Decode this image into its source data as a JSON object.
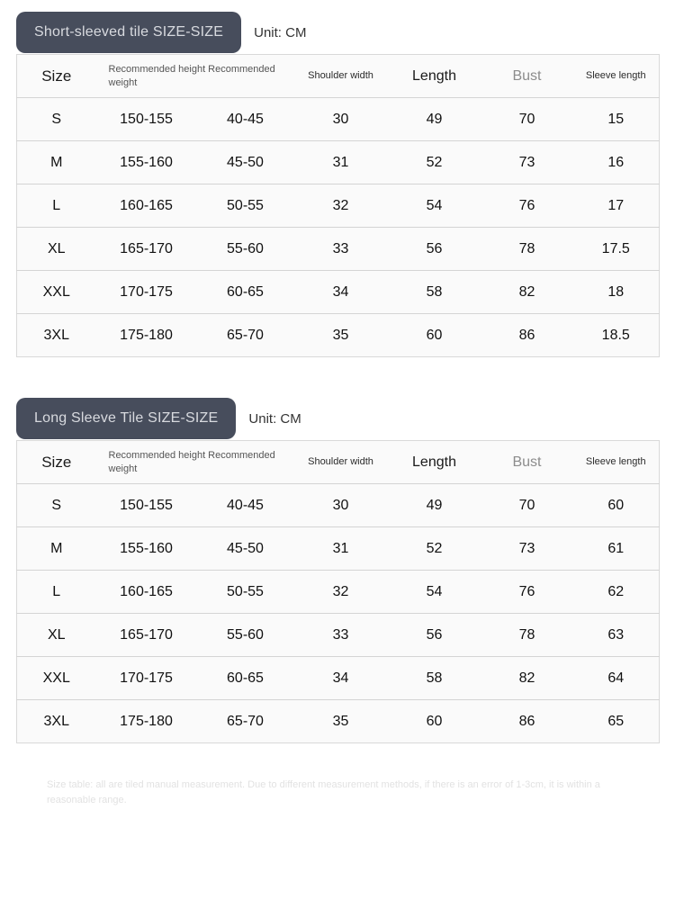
{
  "sections": [
    {
      "badge_label": "Short-sleeved tile SIZE-SIZE",
      "unit_label": "Unit: CM",
      "headers": {
        "size": "Size",
        "recommended": "Recommended height Recommended weight",
        "shoulder": "Shoulder width",
        "length": "Length",
        "bust": "Bust",
        "sleeve": "Sleeve length"
      },
      "rows": [
        {
          "size": "S",
          "height": "150-155",
          "weight": "40-45",
          "shoulder": "30",
          "length": "49",
          "bust": "70",
          "sleeve": "15"
        },
        {
          "size": "M",
          "height": "155-160",
          "weight": "45-50",
          "shoulder": "31",
          "length": "52",
          "bust": "73",
          "sleeve": "16"
        },
        {
          "size": "L",
          "height": "160-165",
          "weight": "50-55",
          "shoulder": "32",
          "length": "54",
          "bust": "76",
          "sleeve": "17"
        },
        {
          "size": "XL",
          "height": "165-170",
          "weight": "55-60",
          "shoulder": "33",
          "length": "56",
          "bust": "78",
          "sleeve": "17.5"
        },
        {
          "size": "XXL",
          "height": "170-175",
          "weight": "60-65",
          "shoulder": "34",
          "length": "58",
          "bust": "82",
          "sleeve": "18"
        },
        {
          "size": "3XL",
          "height": "175-180",
          "weight": "65-70",
          "shoulder": "35",
          "length": "60",
          "bust": "86",
          "sleeve": "18.5"
        }
      ]
    },
    {
      "badge_label": "Long Sleeve Tile SIZE-SIZE",
      "unit_label": "Unit: CM",
      "headers": {
        "size": "Size",
        "recommended": "Recommended height Recommended weight",
        "shoulder": "Shoulder width",
        "length": "Length",
        "bust": "Bust",
        "sleeve": "Sleeve length"
      },
      "rows": [
        {
          "size": "S",
          "height": "150-155",
          "weight": "40-45",
          "shoulder": "30",
          "length": "49",
          "bust": "70",
          "sleeve": "60"
        },
        {
          "size": "M",
          "height": "155-160",
          "weight": "45-50",
          "shoulder": "31",
          "length": "52",
          "bust": "73",
          "sleeve": "61"
        },
        {
          "size": "L",
          "height": "160-165",
          "weight": "50-55",
          "shoulder": "32",
          "length": "54",
          "bust": "76",
          "sleeve": "62"
        },
        {
          "size": "XL",
          "height": "165-170",
          "weight": "55-60",
          "shoulder": "33",
          "length": "56",
          "bust": "78",
          "sleeve": "63"
        },
        {
          "size": "XXL",
          "height": "170-175",
          "weight": "60-65",
          "shoulder": "34",
          "length": "58",
          "bust": "82",
          "sleeve": "64"
        },
        {
          "size": "3XL",
          "height": "175-180",
          "weight": "65-70",
          "shoulder": "35",
          "length": "60",
          "bust": "86",
          "sleeve": "65"
        }
      ]
    }
  ],
  "footnote": "Size table: all are tiled manual measurement. Due to different measurement methods, if there is an error of 1-3cm, it is within a reasonable range.",
  "colors": {
    "badge_background": "#474d5c",
    "badge_text": "#d8dadf",
    "table_background": "#fafafa",
    "table_border": "#d9d9d9",
    "row_divider": "#d4d4d4",
    "muted_header_text": "#8c8c8c",
    "footnote_text": "#e2e2e2"
  }
}
